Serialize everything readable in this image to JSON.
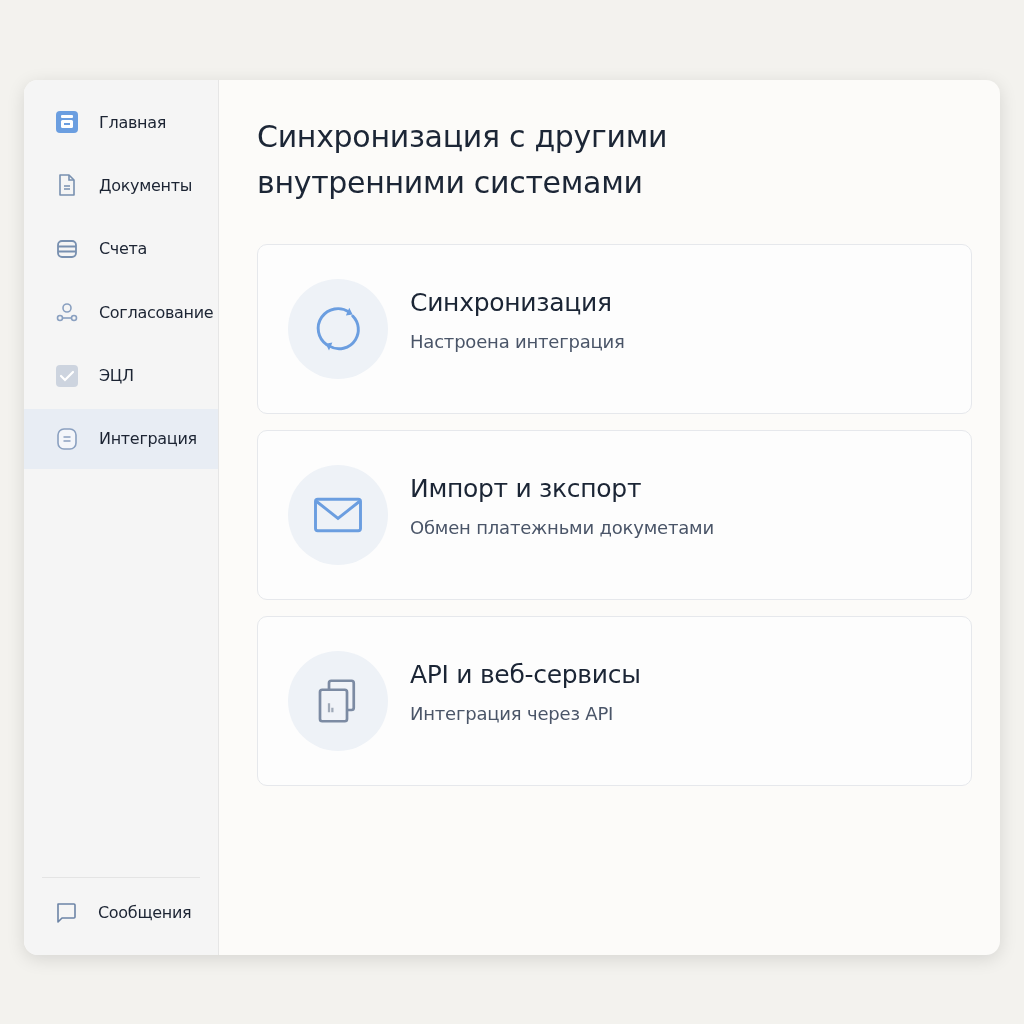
{
  "sidebar": {
    "items": [
      {
        "label": "Главная",
        "kind": "home",
        "selected": false
      },
      {
        "label": "Документы",
        "kind": "document",
        "selected": false
      },
      {
        "label": "Счета",
        "kind": "stack",
        "selected": false
      },
      {
        "label": "Согласование",
        "kind": "approval",
        "selected": false
      },
      {
        "label": "ЭЦЛ",
        "kind": "check",
        "selected": false
      },
      {
        "label": "Интеграция",
        "kind": "note",
        "selected": true
      }
    ],
    "footer": {
      "label": "Сообщения"
    }
  },
  "page": {
    "title": "Синхронизация с другими внутренними системами",
    "cards": [
      {
        "kind": "sync",
        "title": "Синхронизация",
        "subtitle": "Настроена интеграция"
      },
      {
        "kind": "mail",
        "title": "Импорт и зкспорт",
        "subtitle": "Обмен платежньми докуметами"
      },
      {
        "kind": "windows",
        "title": "API и веб-сервисы",
        "subtitle": "Интеграция через API"
      }
    ]
  }
}
